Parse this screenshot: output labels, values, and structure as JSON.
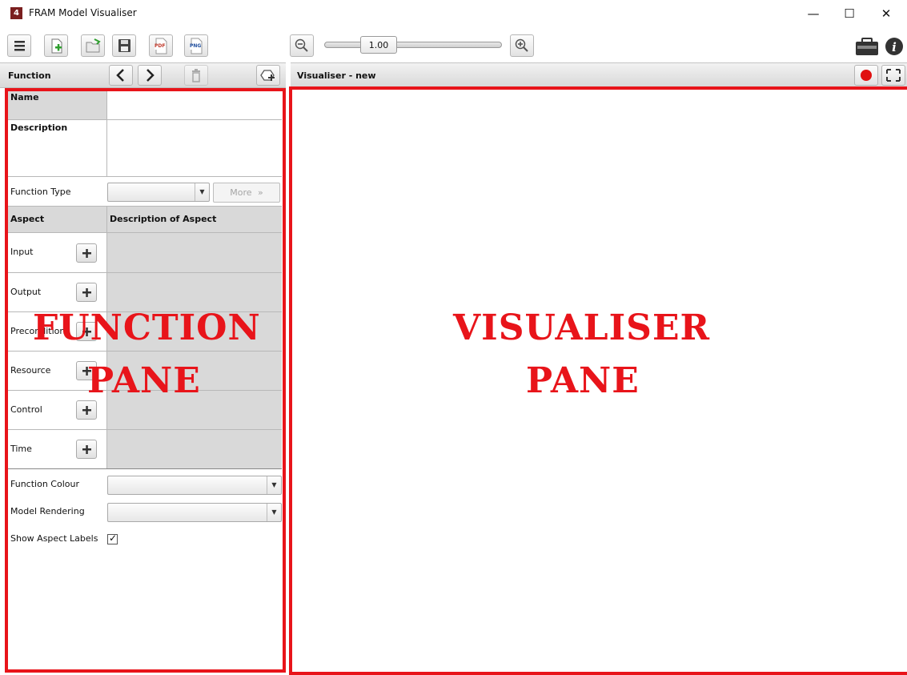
{
  "window": {
    "title": "FRAM Model Visualiser",
    "minimize": "—",
    "maximize": "☐",
    "close": "✕"
  },
  "toolbar": {
    "pdf_label": "PDF",
    "png_label": "PNG",
    "zoom_value": "1.00"
  },
  "function_pane": {
    "header": "Function",
    "name_label": "Name",
    "description_label": "Description",
    "function_type_label": "Function Type",
    "function_type_value": "",
    "more_label": "More",
    "more_icon": "»",
    "aspect_header": "Aspect",
    "description_of_aspect_header": "Description of Aspect",
    "aspects": [
      {
        "label": "Input"
      },
      {
        "label": "Output"
      },
      {
        "label": "Precondition"
      },
      {
        "label": "Resource"
      },
      {
        "label": "Control"
      },
      {
        "label": "Time"
      }
    ],
    "function_colour_label": "Function Colour",
    "function_colour_value": "",
    "model_rendering_label": "Model Rendering",
    "model_rendering_value": "",
    "show_aspect_labels_label": "Show Aspect Labels",
    "show_aspect_labels_checked": "✓"
  },
  "visualiser_pane": {
    "header": "Visualiser - new"
  },
  "overlay": {
    "function_line1": "FUNCTION",
    "function_line2": "PANE",
    "visualiser_line1": "VISUALISER",
    "visualiser_line2": "PANE"
  },
  "colors": {
    "highlight_red": "#e8141a",
    "record_red": "#e01010"
  }
}
